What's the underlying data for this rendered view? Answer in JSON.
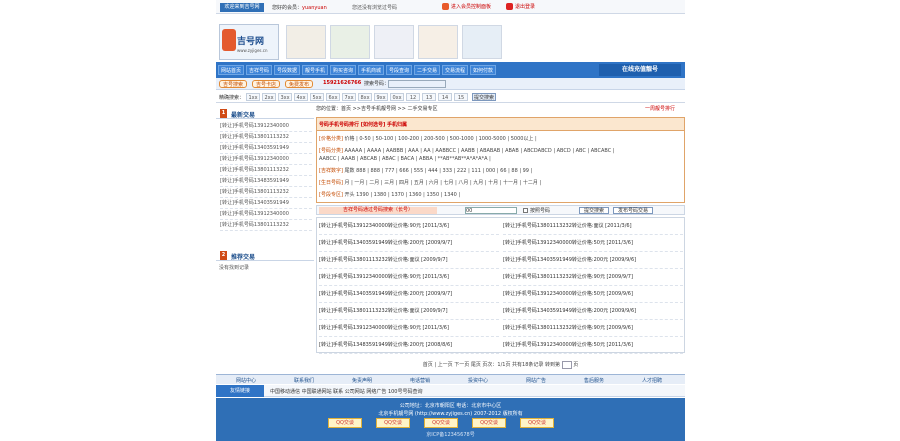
{
  "topbar": {
    "home": "欢迎来到吉号网",
    "welcome": "您好的会员：",
    "user": "yuanyuan",
    "note": "您还没有浏览过号码",
    "links": [
      "进入会员控制面板",
      "退出登录"
    ]
  },
  "logo": {
    "title": "吉号网",
    "url": "www.zyjiges.cn"
  },
  "banners": [
    "",
    "",
    "",
    "",
    ""
  ],
  "nav": {
    "items": [
      "网站首页",
      "吉祥号码",
      "号段数据",
      "靓号手机",
      "购买咨询",
      "手机商城",
      "号段查询",
      "二手交易",
      "交易流程",
      "如何付款"
    ],
    "right": "在线充值靓号"
  },
  "row2": {
    "pills": [
      "吉号搜索",
      "吉号卡店",
      "免费发布"
    ],
    "phone": "15921626766",
    "search_label": "搜索号码：",
    "search_value": ""
  },
  "row3": {
    "label": "精确搜索：",
    "tail_label": "",
    "tails": [
      "1xx",
      "2xx",
      "3xx",
      "4xx",
      "5xx",
      "6xx",
      "7xx",
      "8xx",
      "9xx",
      "0xx",
      "12",
      "13",
      "14",
      "15"
    ],
    "go": "提交搜索"
  },
  "left": {
    "section1": {
      "num": "1",
      "title": "最新交易"
    },
    "items": [
      "[转让]手机号码13912340000",
      "[转让]手机号码13801113232",
      "[转让]手机号码13403591949",
      "[转让]手机号码13912340000",
      "[转让]手机号码13801113232",
      "[转让]手机号码13483591949",
      "[转让]手机号码13801113232",
      "[转让]手机号码13403591949",
      "[转让]手机号码13912340000",
      "[转让]手机号码13801113232"
    ],
    "section2": {
      "num": "2",
      "title": "推荐交易"
    },
    "recommend": "没有找到记录"
  },
  "main": {
    "crumb": "您的位置：首页 >>吉号手机靓号网 >> 二手交易专区",
    "more": "一周靓号排行",
    "filter_header": "号码手机号码排行 [如何选号] 手机归属",
    "filters": [
      {
        "k": "[价格分类]",
        "v": "价格 | 0-50 | 50-100 | 100-200 | 200-500 | 500-1000 | 1000-5000 | 5000以上 |"
      },
      {
        "k": "[号码分类]",
        "v": "AAAAA | AAAA | AABBB | AAA | AA | AABBCC | AABB | ABABAB | ABAB | ABCDABCD | ABCD | ABC | ABCABC |"
      },
      {
        "k": "",
        "v": "AABCC | AAAB | ABCAB | ABAC | BACA | ABBA | **AB**AB**A*A*A*A |"
      },
      {
        "k": "[吉祥数字]",
        "v": "尾数 888 | 888 | 777 | 666 | 555 | 444 | 333 | 222 | 111 | 000 | 66 | 88 | 99 |"
      },
      {
        "k": "[生日号码]",
        "v": "月 | 一月 | 二月 | 三月 | 四月 | 五月 | 六月 | 七月 | 八月 | 九月 | 十月 | 十一月 | 十二月 |"
      },
      {
        "k": "[号段专区]",
        "v": "开头 1390 | 1380 | 1370 | 1360 | 1350 | 1340 |"
      }
    ],
    "bar": {
      "hl": "吉祥号码通过号码搜索（长号）",
      "input": "00",
      "check": "按照号码",
      "b1": "提交搜索",
      "b2": "发布号码交易"
    },
    "listings": [
      [
        "[转让]手机号码13912340000转让价格:90元 [2011/3/6]",
        "[转让]手机号码13801113232转让价格:面议 [2011/3/6]"
      ],
      [
        "[转让]手机号码13403591949转让价格:200元 [2009/9/7]",
        "[转让]手机号码13912340000转让价格:50元 [2011/3/6]"
      ],
      [
        "[转让]手机号码13801113232转让价格:面议 [2009/9/7]",
        "[转让]手机号码13403591949转让价格:200元 [2009/9/6]"
      ],
      [
        "[转让]手机号码13912340000转让价格:90元 [2011/3/6]",
        "[转让]手机号码13801113232转让价格:90元 [2009/9/7]"
      ],
      [
        "[转让]手机号码13403591949转让价格:200元 [2009/9/7]",
        "[转让]手机号码13912340000转让价格:50元 [2009/9/6]"
      ],
      [
        "[转让]手机号码13801113232转让价格:面议 [2009/9/7]",
        "[转让]手机号码13403591949转让价格:200元 [2009/9/6]"
      ],
      [
        "[转让]手机号码13912340000转让价格:90元 [2011/3/6]",
        "[转让]手机号码13801113232转让价格:90元 [2009/9/6]"
      ],
      [
        "[转让]手机号码13483591949转让价格:200元 [2008/8/6]",
        "[转让]手机号码13912340000转让价格:50元 [2011/3/6]"
      ]
    ],
    "pager": "首页 | 上一页 下一页 尾页 页次：1/1页 共有18条记录 转到第",
    "pager_end": "页"
  },
  "footer": {
    "nav": [
      "网站中心",
      "联系我们",
      "免责声明",
      "电话营销",
      "投资中心",
      "网站广告",
      "售后服务",
      "人才招聘"
    ],
    "friend_label": "友情链接",
    "friend_text": "中国移动通信 中国联通网站 联系 公司网站 网络广告 100号号码查询",
    "l1": "公司地址：北京市朝阳区 电话：北京市中心区",
    "l2": "北京手机靓号网 (http://www.zyjiges.cn) 2007-2012 版权所有",
    "qq": [
      "QQ交谈",
      "QQ交谈",
      "QQ交谈",
      "QQ交谈",
      "QQ交谈"
    ],
    "l3": "京ICP备12345678号"
  }
}
